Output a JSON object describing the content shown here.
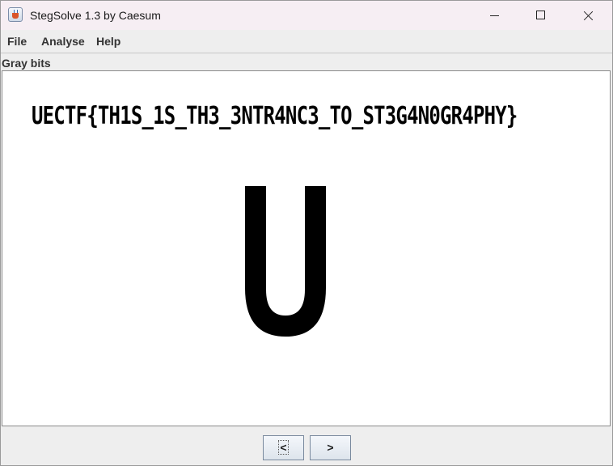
{
  "window": {
    "title": "StegSolve 1.3 by Caesum",
    "icon": "java-cup-icon"
  },
  "window_controls": {
    "minimize_icon": "minimize-icon",
    "maximize_icon": "maximize-icon",
    "close_icon": "close-icon"
  },
  "menu": {
    "items": [
      {
        "label": "File"
      },
      {
        "label": "Analyse"
      },
      {
        "label": "Help"
      }
    ]
  },
  "panel": {
    "label": "Gray bits"
  },
  "image": {
    "flag_text": "UECTF{TH1S_1S_TH3_3NTR4NC3_TO_ST3G4N0GR4PHY}",
    "large_glyph": "U"
  },
  "navigation": {
    "prev_label": "<",
    "next_label": ">"
  }
}
